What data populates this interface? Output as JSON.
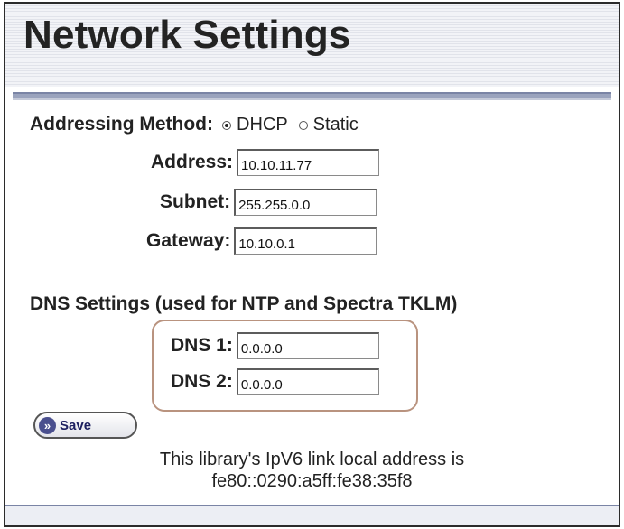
{
  "page": {
    "title": "Network Settings"
  },
  "addressing": {
    "label": "Addressing Method:",
    "options": [
      "DHCP",
      "Static"
    ],
    "selected": "DHCP"
  },
  "fields": {
    "address": {
      "label": "Address:",
      "value": "10.10.11.77"
    },
    "subnet": {
      "label": "Subnet:",
      "value": "255.255.0.0"
    },
    "gateway": {
      "label": "Gateway:",
      "value": "10.10.0.1"
    }
  },
  "dns": {
    "heading": "DNS Settings (used for NTP and Spectra TKLM)",
    "dns1": {
      "label": "DNS 1:",
      "value": "0.0.0.0"
    },
    "dns2": {
      "label": "DNS 2:",
      "value": "0.0.0.0"
    }
  },
  "actions": {
    "save_label": "Save",
    "save_icon": "double-chevron-right-icon"
  },
  "info": {
    "line1": "This library's IpV6 link local address is",
    "line2": "fe80::0290:a5ff:fe38:35f8"
  },
  "colors": {
    "header_bg": "#eceef4",
    "rule": "#9aa3bd",
    "dns_outline": "#b9937f",
    "button_icon": "#4a4f8e"
  }
}
